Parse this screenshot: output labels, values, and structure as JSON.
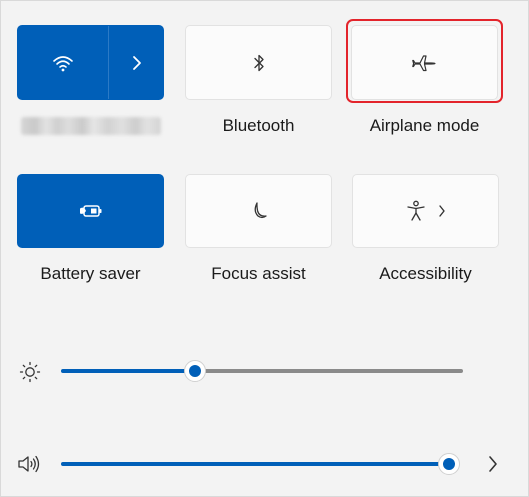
{
  "tiles": {
    "wifi": {
      "active": true
    },
    "bluetooth": {
      "label": "Bluetooth",
      "active": false
    },
    "airplane": {
      "label": "Airplane mode",
      "active": false,
      "highlighted": true
    },
    "battery_saver": {
      "label": "Battery saver",
      "active": true
    },
    "focus_assist": {
      "label": "Focus assist",
      "active": false
    },
    "accessibility": {
      "label": "Accessibility",
      "active": false
    }
  },
  "sliders": {
    "brightness": {
      "icon": "sun-icon",
      "value_percent": 30
    },
    "volume": {
      "icon": "speaker-icon",
      "value_percent": 97
    }
  },
  "icons": {
    "wifi": "wifi-icon",
    "wifi_expand": "chevron-right-icon",
    "bluetooth": "bluetooth-icon",
    "airplane": "airplane-icon",
    "battery_saver": "battery-saver-icon",
    "focus_assist": "moon-icon",
    "accessibility": "accessibility-icon",
    "accessibility_expand": "chevron-right-icon",
    "volume_expand": "chevron-right-icon"
  },
  "colors": {
    "accent": "#005fb8",
    "highlight_border": "#e3242b",
    "track_inactive": "#8a8a8a"
  }
}
